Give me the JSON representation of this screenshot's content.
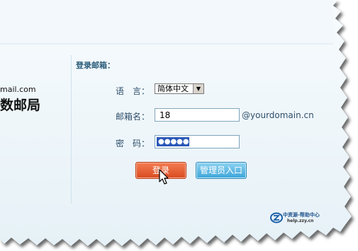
{
  "left_panel": {
    "email_fragment": "mail.com",
    "title_fragment": "数邮局"
  },
  "login_form": {
    "section_title": "登录邮箱：",
    "language_label": "语　言：",
    "language_value": "简体中文",
    "mailbox_label": "邮箱名：",
    "mailbox_value": "18",
    "domain_suffix": "@yourdomain.cn",
    "password_label": "密　码：",
    "password_mask": "●●●●●●",
    "login_button": "登录",
    "admin_button": "管理员入口"
  },
  "watermark": {
    "brand": "中资源-帮助中心",
    "url": "help.zzy.cn"
  },
  "colors": {
    "page_bg": "#eef6fa",
    "accent_text": "#2a5c7a",
    "login_button": "#e35a2e",
    "admin_button": "#5ab8e4"
  }
}
